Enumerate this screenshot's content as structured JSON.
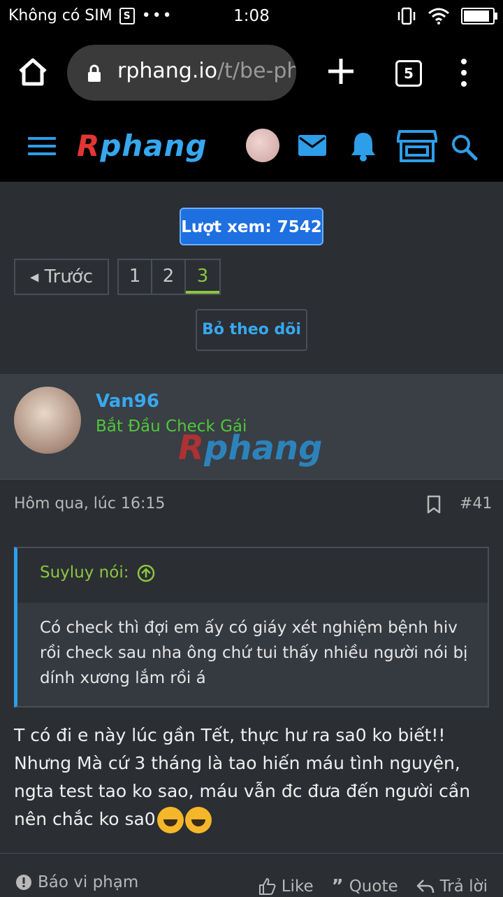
{
  "statusbar": {
    "carrier": "Không có SIM",
    "time": "1:08",
    "battery_fraction": 0.95
  },
  "browser": {
    "url_host": "rphang.io",
    "url_path": "/t/be-ph",
    "tab_count": "5"
  },
  "site": {
    "logo_first": "R",
    "logo_rest": "phang"
  },
  "thread": {
    "views_label": "Lượt xem: 7542",
    "prev_label": "Trước",
    "pages": [
      "1",
      "2",
      "3"
    ],
    "active_page": "3",
    "unfollow_label": "Bỏ theo dõi"
  },
  "post": {
    "username": "Van96",
    "user_title": "Bắt Đầu Check Gái",
    "watermark_first": "R",
    "watermark_rest": "phang",
    "date": "Hôm qua, lúc 16:15",
    "number": "#41",
    "quote_author": "Suyluy nói:",
    "quote_text": "Có check thì đợi em ấy có giáy xét nghiệm bệnh hiv rồi check sau nha ông chứ tui thấy nhiều người nói bị dính xương lắm rồi á",
    "message": "T có đi e này lúc gần Tết, thực hư ra sa0 ko biết!! Nhưng Mà cứ 3 tháng là tao hiến máu tình nguyện, ngta test tao ko sao, máu vẫn đc đưa đến người cần nên chắc ko sa0",
    "report_label": "Báo vi phạm",
    "like_label": "Like",
    "quote_label": "Quote",
    "reply_label": "Trả lời"
  }
}
